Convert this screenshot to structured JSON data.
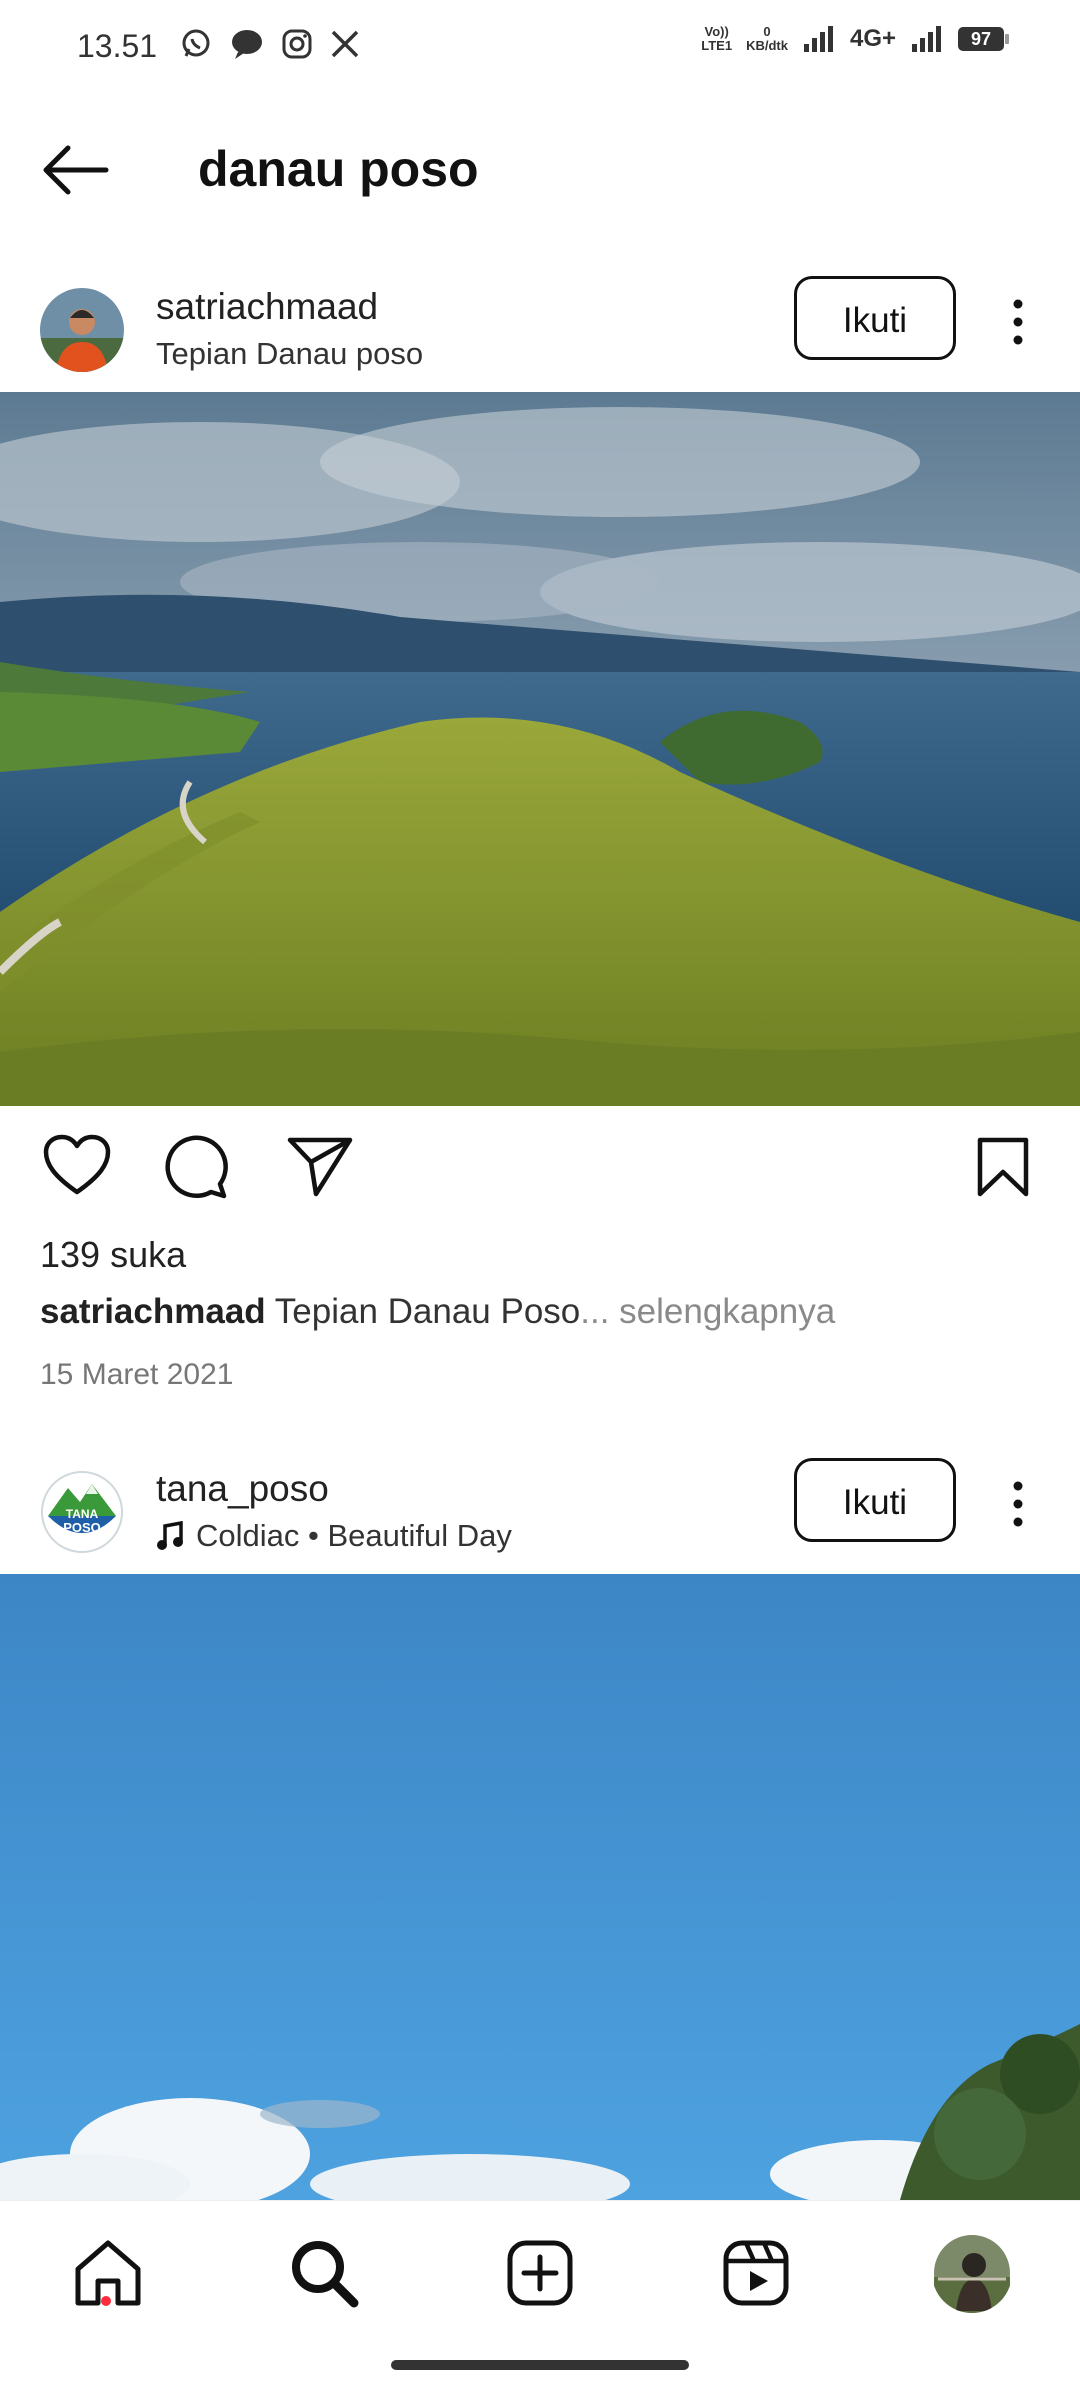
{
  "status_bar": {
    "time": "13.51",
    "volte_line1": "Vo))",
    "volte_line2": "LTE1",
    "speed_value": "0",
    "speed_unit": "KB/dtk",
    "network": "4G+",
    "battery": "97"
  },
  "header": {
    "title": "danau poso"
  },
  "posts": [
    {
      "username": "satriachmaad",
      "location": "Tepian Danau poso",
      "follow_label": "Ikuti",
      "likes": "139 suka",
      "caption_user": "satriachmaad",
      "caption_text": "Tepian Danau Poso",
      "caption_ellipsis": "...",
      "caption_more": " selengkapnya",
      "date": "15 Maret 2021"
    },
    {
      "username": "tana_poso",
      "music": "Coldiac • Beautiful Day",
      "follow_label": "Ikuti",
      "avatar_text_1": "TANA",
      "avatar_text_2": "POSO"
    }
  ],
  "bottom_nav": {
    "items": [
      "home-icon",
      "search-icon",
      "create-icon",
      "reels-icon",
      "profile-avatar"
    ]
  },
  "colors": {
    "accent_dot": "#ff2b3d",
    "sky": "#3f8fd1"
  }
}
